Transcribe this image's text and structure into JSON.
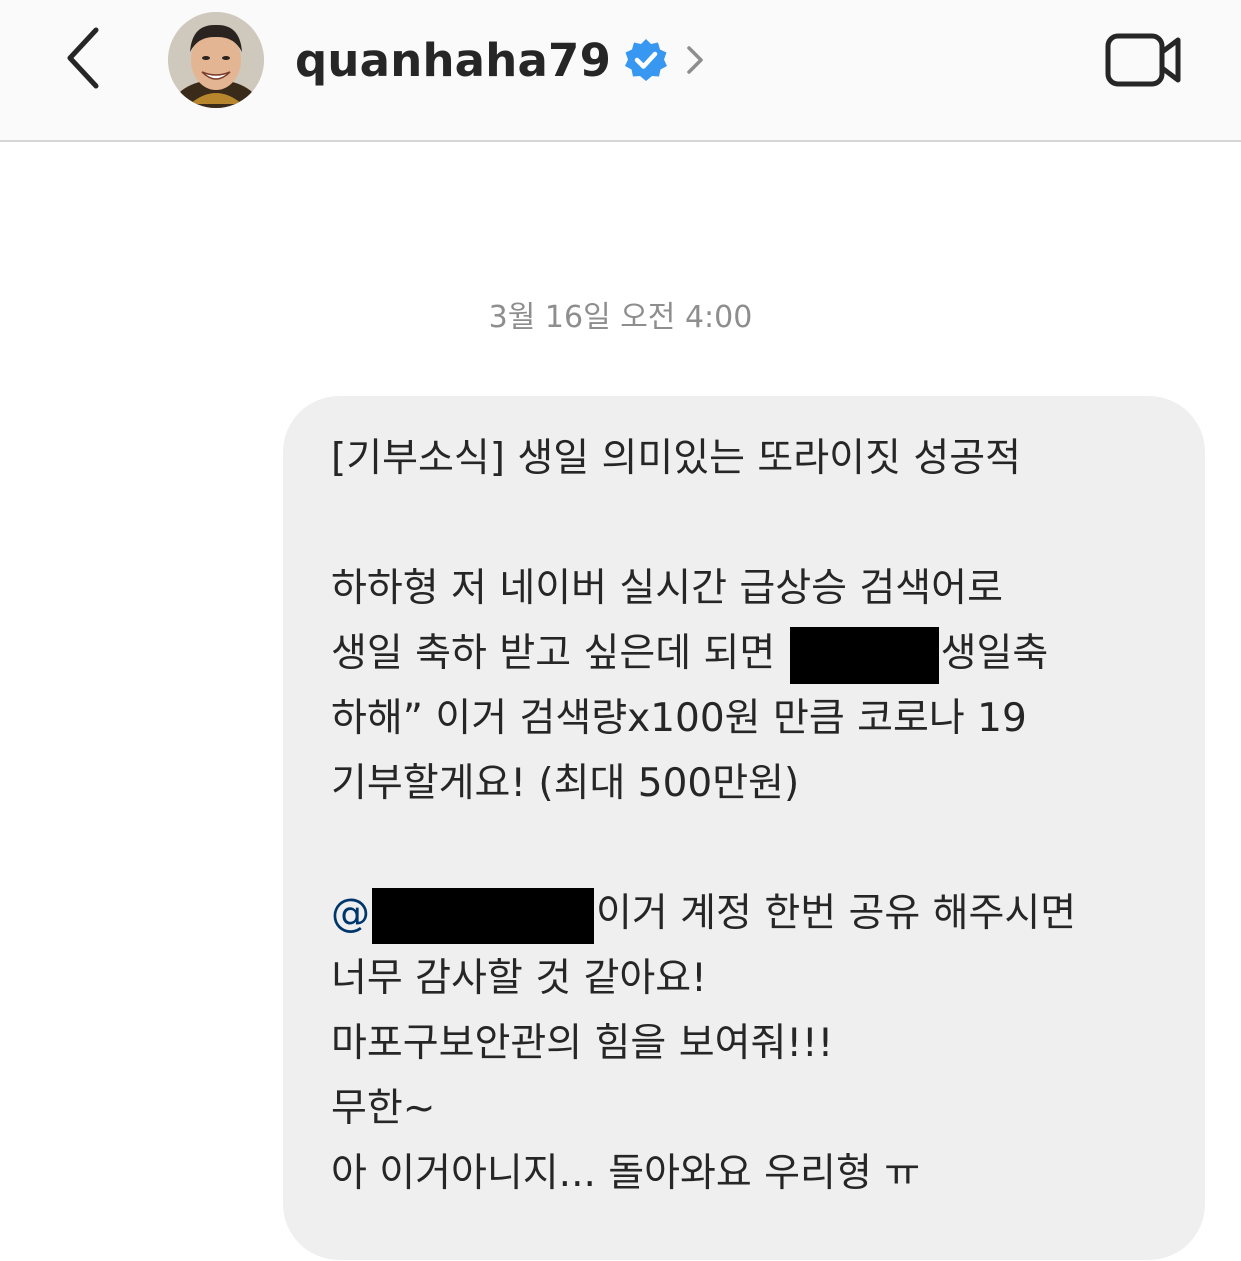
{
  "header": {
    "username": "quanhaha79",
    "icons": {
      "back": "chevron-left-icon",
      "verified": "verified-badge-icon",
      "profile_link": "chevron-right-icon",
      "video_call": "video-camera-icon"
    },
    "colors": {
      "verified": "#3897f0",
      "header_bg": "#fafafa"
    }
  },
  "thread": {
    "timestamp": "3월 16일 오전 4:00"
  },
  "message": {
    "line1": "[기부소식] 생일 의미있는 또라이짓 성공적",
    "line2": "하하형 저 네이버 실시간 급상승 검색어로",
    "line3a": "생일 축하 받고 싶은데 되면 ",
    "line3b": "생일축",
    "line4": "하해” 이거 검색량x100원 만큼 코로나 19",
    "line5": "기부할게요! (최대 500만원)",
    "mention_at": "@",
    "line6b": "이거 계정 한번 공유 해주시면",
    "line7": "너무 감사할 것 같아요!",
    "line8": "마포구보안관의 힘을 보여줘!!!",
    "line9": "무한~",
    "line10": "아 이거아니지... 돌아와요 우리형 ㅠ",
    "bubble_color": "#efefef",
    "mention_color": "#00376b"
  }
}
